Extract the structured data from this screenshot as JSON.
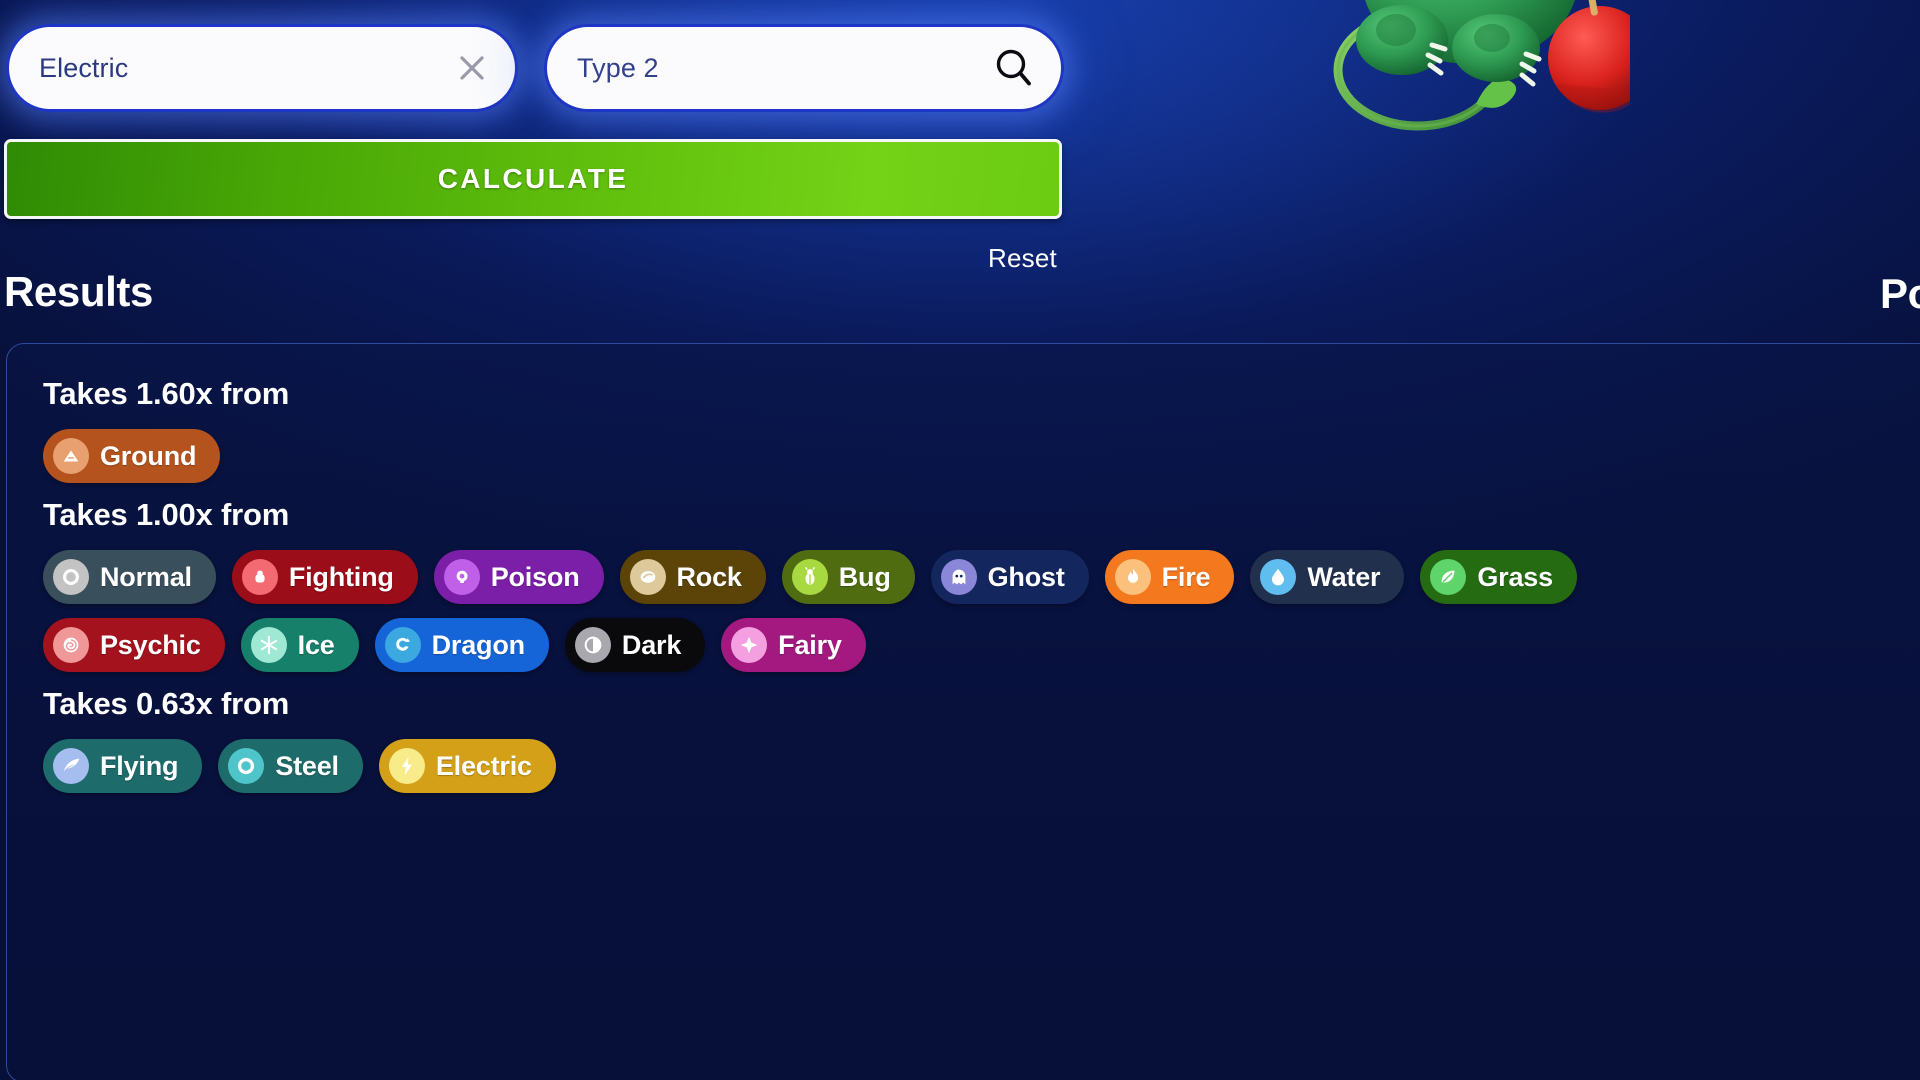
{
  "search": {
    "type1": {
      "value": "Electric",
      "clear_icon": "close-x-icon"
    },
    "type2": {
      "placeholder": "Type 2",
      "value": "Type 2",
      "search_icon": "magnifier-icon"
    }
  },
  "actions": {
    "calculate_label": "CALCULATE",
    "reset_label": "Reset"
  },
  "headings": {
    "results": "Results",
    "pokemon": "Pokémon"
  },
  "colors": {
    "background": "#0a1a5c",
    "calculate_green": "#62c10d",
    "field_border": "#1f35c4",
    "card_border": "#2e4ba0"
  },
  "results": {
    "groups": [
      {
        "title": "Takes 1.60x from",
        "multiplier": "1.60x",
        "rows": [
          [
            {
              "name": "Ground",
              "icon": "ground-icon",
              "pill": "#b5531e",
              "dot": "#e8a071"
            }
          ]
        ]
      },
      {
        "title": "Takes 1.00x from",
        "multiplier": "1.00x",
        "rows": [
          [
            {
              "name": "Normal",
              "icon": "normal-icon",
              "pill": "#3a4f5c",
              "dot": "#c3c3c3"
            },
            {
              "name": "Fighting",
              "icon": "fighting-icon",
              "pill": "#9b0d18",
              "dot": "#f36a72"
            },
            {
              "name": "Poison",
              "icon": "poison-icon",
              "pill": "#7b1fa8",
              "dot": "#c060e8"
            },
            {
              "name": "Rock",
              "icon": "rock-icon",
              "pill": "#5c4409",
              "dot": "#ddc99a"
            },
            {
              "name": "Bug",
              "icon": "bug-icon",
              "pill": "#4f6c10",
              "dot": "#a9d940"
            },
            {
              "name": "Ghost",
              "icon": "ghost-icon",
              "pill": "#14265e",
              "dot": "#8b87d8"
            },
            {
              "name": "Fire",
              "icon": "fire-icon",
              "pill": "#f4781e",
              "dot": "#fbc07c"
            },
            {
              "name": "Water",
              "icon": "water-icon",
              "pill": "#21304d",
              "dot": "#5fbdf0"
            },
            {
              "name": "Grass",
              "icon": "grass-icon",
              "pill": "#256b12",
              "dot": "#5ed46a"
            }
          ],
          [
            {
              "name": "Psychic",
              "icon": "psychic-icon",
              "pill": "#a4121e",
              "dot": "#f09898"
            },
            {
              "name": "Ice",
              "icon": "ice-icon",
              "pill": "#17806a",
              "dot": "#9fe8d4"
            },
            {
              "name": "Dragon",
              "icon": "dragon-icon",
              "pill": "#1565d8",
              "dot": "#3ba8e0"
            },
            {
              "name": "Dark",
              "icon": "dark-icon",
              "pill": "#0a0a0c",
              "dot": "#a8a8ae"
            },
            {
              "name": "Fairy",
              "icon": "fairy-icon",
              "pill": "#a3197f",
              "dot": "#f49fe0"
            }
          ]
        ]
      },
      {
        "title": "Takes 0.63x from",
        "multiplier": "0.63x",
        "rows": [
          [
            {
              "name": "Flying",
              "icon": "flying-icon",
              "pill": "#1e6b6b",
              "dot": "#a6bdf0"
            },
            {
              "name": "Steel",
              "icon": "steel-icon",
              "pill": "#1e6b6b",
              "dot": "#4fc4c9"
            },
            {
              "name": "Electric",
              "icon": "electric-icon",
              "pill": "#d4a017",
              "dot": "#f7eb8a"
            }
          ]
        ]
      }
    ]
  }
}
